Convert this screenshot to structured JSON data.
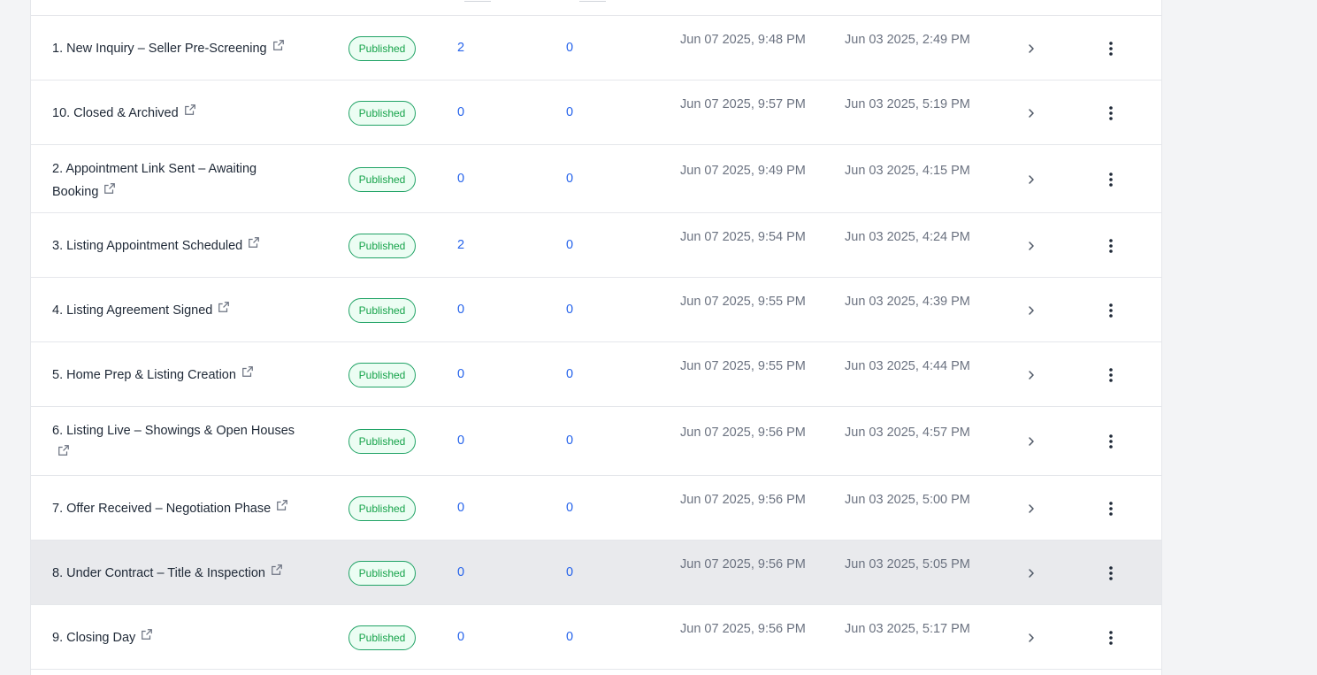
{
  "status_label": "Published",
  "rows": [
    {
      "name": "1. New Inquiry – Seller Pre-Screening",
      "status": "Published",
      "count_a": "2",
      "count_b": "0",
      "updated": "Jun 07 2025, 9:48 PM",
      "created": "Jun 03 2025, 2:49 PM"
    },
    {
      "name": "10. Closed & Archived",
      "status": "Published",
      "count_a": "0",
      "count_b": "0",
      "updated": "Jun 07 2025, 9:57 PM",
      "created": "Jun 03 2025, 5:19 PM"
    },
    {
      "name": "2. Appointment Link Sent – Awaiting Booking",
      "status": "Published",
      "count_a": "0",
      "count_b": "0",
      "updated": "Jun 07 2025, 9:49 PM",
      "created": "Jun 03 2025, 4:15 PM"
    },
    {
      "name": "3. Listing Appointment Scheduled",
      "status": "Published",
      "count_a": "2",
      "count_b": "0",
      "updated": "Jun 07 2025, 9:54 PM",
      "created": "Jun 03 2025, 4:24 PM"
    },
    {
      "name": "4. Listing Agreement Signed",
      "status": "Published",
      "count_a": "0",
      "count_b": "0",
      "updated": "Jun 07 2025, 9:55 PM",
      "created": "Jun 03 2025, 4:39 PM"
    },
    {
      "name": "5. Home Prep & Listing Creation",
      "status": "Published",
      "count_a": "0",
      "count_b": "0",
      "updated": "Jun 07 2025, 9:55 PM",
      "created": "Jun 03 2025, 4:44 PM"
    },
    {
      "name": "6. Listing Live – Showings & Open Houses",
      "status": "Published",
      "count_a": "0",
      "count_b": "0",
      "updated": "Jun 07 2025, 9:56 PM",
      "created": "Jun 03 2025, 4:57 PM"
    },
    {
      "name": "7. Offer Received – Negotiation Phase",
      "status": "Published",
      "count_a": "0",
      "count_b": "0",
      "updated": "Jun 07 2025, 9:56 PM",
      "created": "Jun 03 2025, 5:00 PM"
    },
    {
      "name": "8. Under Contract – Title & Inspection",
      "status": "Published",
      "count_a": "0",
      "count_b": "0",
      "updated": "Jun 07 2025, 9:56 PM",
      "created": "Jun 03 2025, 5:05 PM"
    },
    {
      "name": "9. Closing Day",
      "status": "Published",
      "count_a": "0",
      "count_b": "0",
      "updated": "Jun 07 2025, 9:56 PM",
      "created": "Jun 03 2025, 5:17 PM"
    }
  ],
  "hovered_row": 8,
  "colors": {
    "accent_link": "#2563eb",
    "status_green": "#16a34a",
    "hover_bg": "#e9eaed"
  },
  "icons": {
    "row_external": "external-link-icon",
    "row_expand": "chevron-right-icon",
    "row_menu": "kebab-menu-icon"
  }
}
